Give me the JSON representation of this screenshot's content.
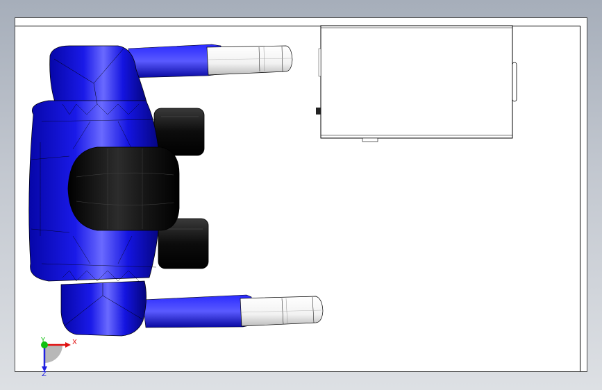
{
  "triad": {
    "x_label": "X",
    "y_label": "Y",
    "z_label": "Z"
  },
  "colors": {
    "background_top": "#a6aeba",
    "background_bottom": "#dde0e4",
    "sheet": "#ffffff",
    "body_blue": "#1010e0",
    "body_dark": "#050590",
    "seat_black": "#101010",
    "leg_white": "#f4f4f4",
    "axis_x": "#e01010",
    "axis_y": "#10c010",
    "axis_z": "#1010e0"
  }
}
